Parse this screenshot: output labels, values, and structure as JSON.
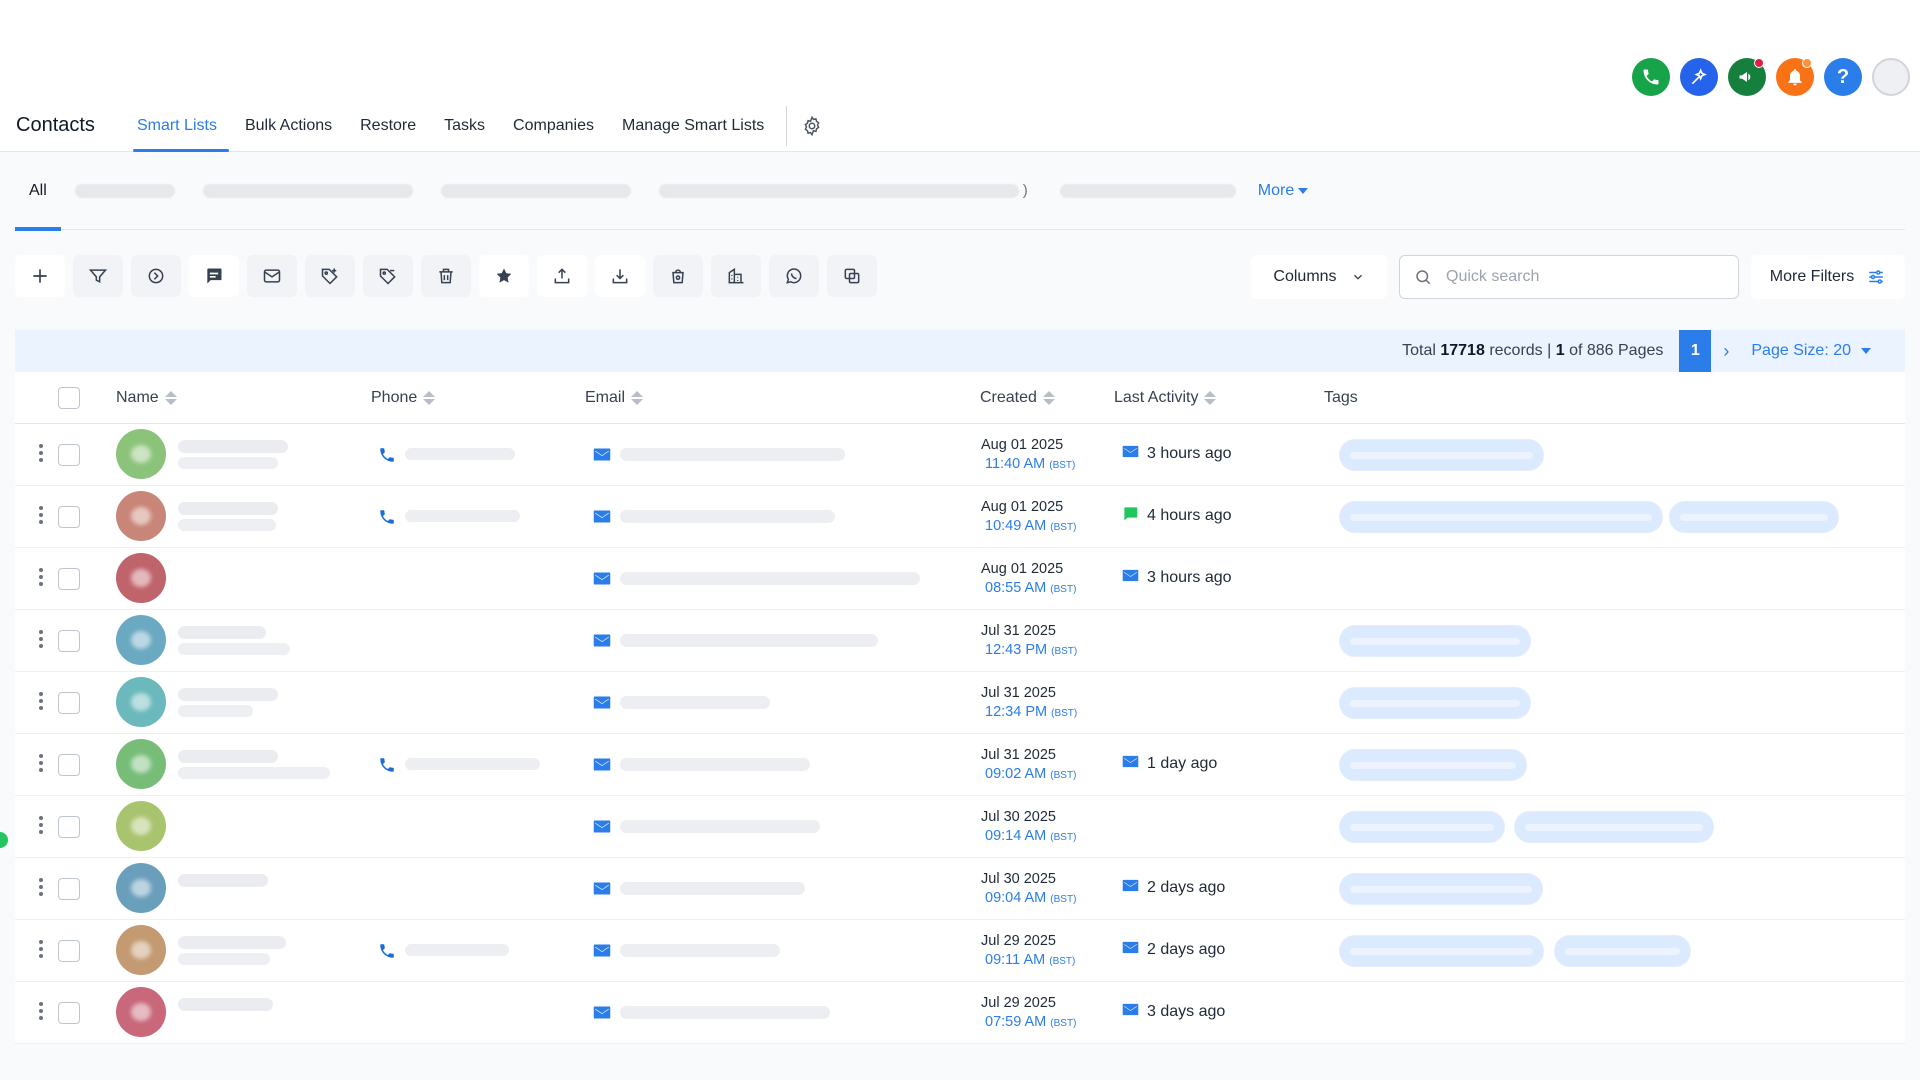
{
  "header": {
    "icons": [
      {
        "name": "phone-call-icon",
        "color": "#16a34a"
      },
      {
        "name": "ai-sparkle-icon",
        "color": "#2563eb"
      },
      {
        "name": "megaphone-icon",
        "color": "#15803d"
      },
      {
        "name": "bell-icon",
        "color": "#f97316"
      },
      {
        "name": "help-icon",
        "color": "#2b7de9"
      },
      {
        "name": "avatar-icon",
        "color": "#e5e7eb"
      }
    ]
  },
  "nav": {
    "title": "Contacts",
    "tabs": [
      "Smart Lists",
      "Bulk Actions",
      "Restore",
      "Tasks",
      "Companies",
      "Manage Smart Lists"
    ],
    "active_tab": "Smart Lists"
  },
  "smart_lists": {
    "all_label": "All",
    "closing_paren": ")",
    "more_label": "More"
  },
  "toolbar": {
    "columns_label": "Columns",
    "search_placeholder": "Quick search",
    "more_filters_label": "More Filters"
  },
  "records": {
    "total_prefix": "Total",
    "total": "17718",
    "records_word": "records |",
    "page": "1",
    "pages_text": "of 886 Pages",
    "current_page": "1",
    "page_size_label": "Page Size: 20"
  },
  "table": {
    "headers": {
      "name": "Name",
      "phone": "Phone",
      "email": "Email",
      "created": "Created",
      "last_activity": "Last Activity",
      "tags": "Tags"
    },
    "rows": [
      {
        "avatar_color": "#8cc37a",
        "date": "Aug 01 2025",
        "time": "11:40 AM",
        "tz": "(BST)",
        "activity": "3 hours ago",
        "activity_type": "email"
      },
      {
        "avatar_color": "#c98577",
        "date": "Aug 01 2025",
        "time": "10:49 AM",
        "tz": "(BST)",
        "activity": "4 hours ago",
        "activity_type": "sms"
      },
      {
        "avatar_color": "#c0646b",
        "date": "Aug 01 2025",
        "time": "08:55 AM",
        "tz": "(BST)",
        "activity": "3 hours ago",
        "activity_type": "email"
      },
      {
        "avatar_color": "#6aa9c1",
        "date": "Jul 31 2025",
        "time": "12:43 PM",
        "tz": "(BST)",
        "activity": "",
        "activity_type": ""
      },
      {
        "avatar_color": "#6bb9bc",
        "date": "Jul 31 2025",
        "time": "12:34 PM",
        "tz": "(BST)",
        "activity": "",
        "activity_type": ""
      },
      {
        "avatar_color": "#77bd78",
        "date": "Jul 31 2025",
        "time": "09:02 AM",
        "tz": "(BST)",
        "activity": "1 day ago",
        "activity_type": "email"
      },
      {
        "avatar_color": "#a9c46e",
        "date": "Jul 30 2025",
        "time": "09:14 AM",
        "tz": "(BST)",
        "activity": "",
        "activity_type": ""
      },
      {
        "avatar_color": "#6a9fbc",
        "date": "Jul 30 2025",
        "time": "09:04 AM",
        "tz": "(BST)",
        "activity": "2 days ago",
        "activity_type": "email"
      },
      {
        "avatar_color": "#c39a72",
        "date": "Jul 29 2025",
        "time": "09:11 AM",
        "tz": "(BST)",
        "activity": "2 days ago",
        "activity_type": "email"
      },
      {
        "avatar_color": "#c8687a",
        "date": "Jul 29 2025",
        "time": "07:59 AM",
        "tz": "(BST)",
        "activity": "3 days ago",
        "activity_type": "email"
      }
    ]
  }
}
